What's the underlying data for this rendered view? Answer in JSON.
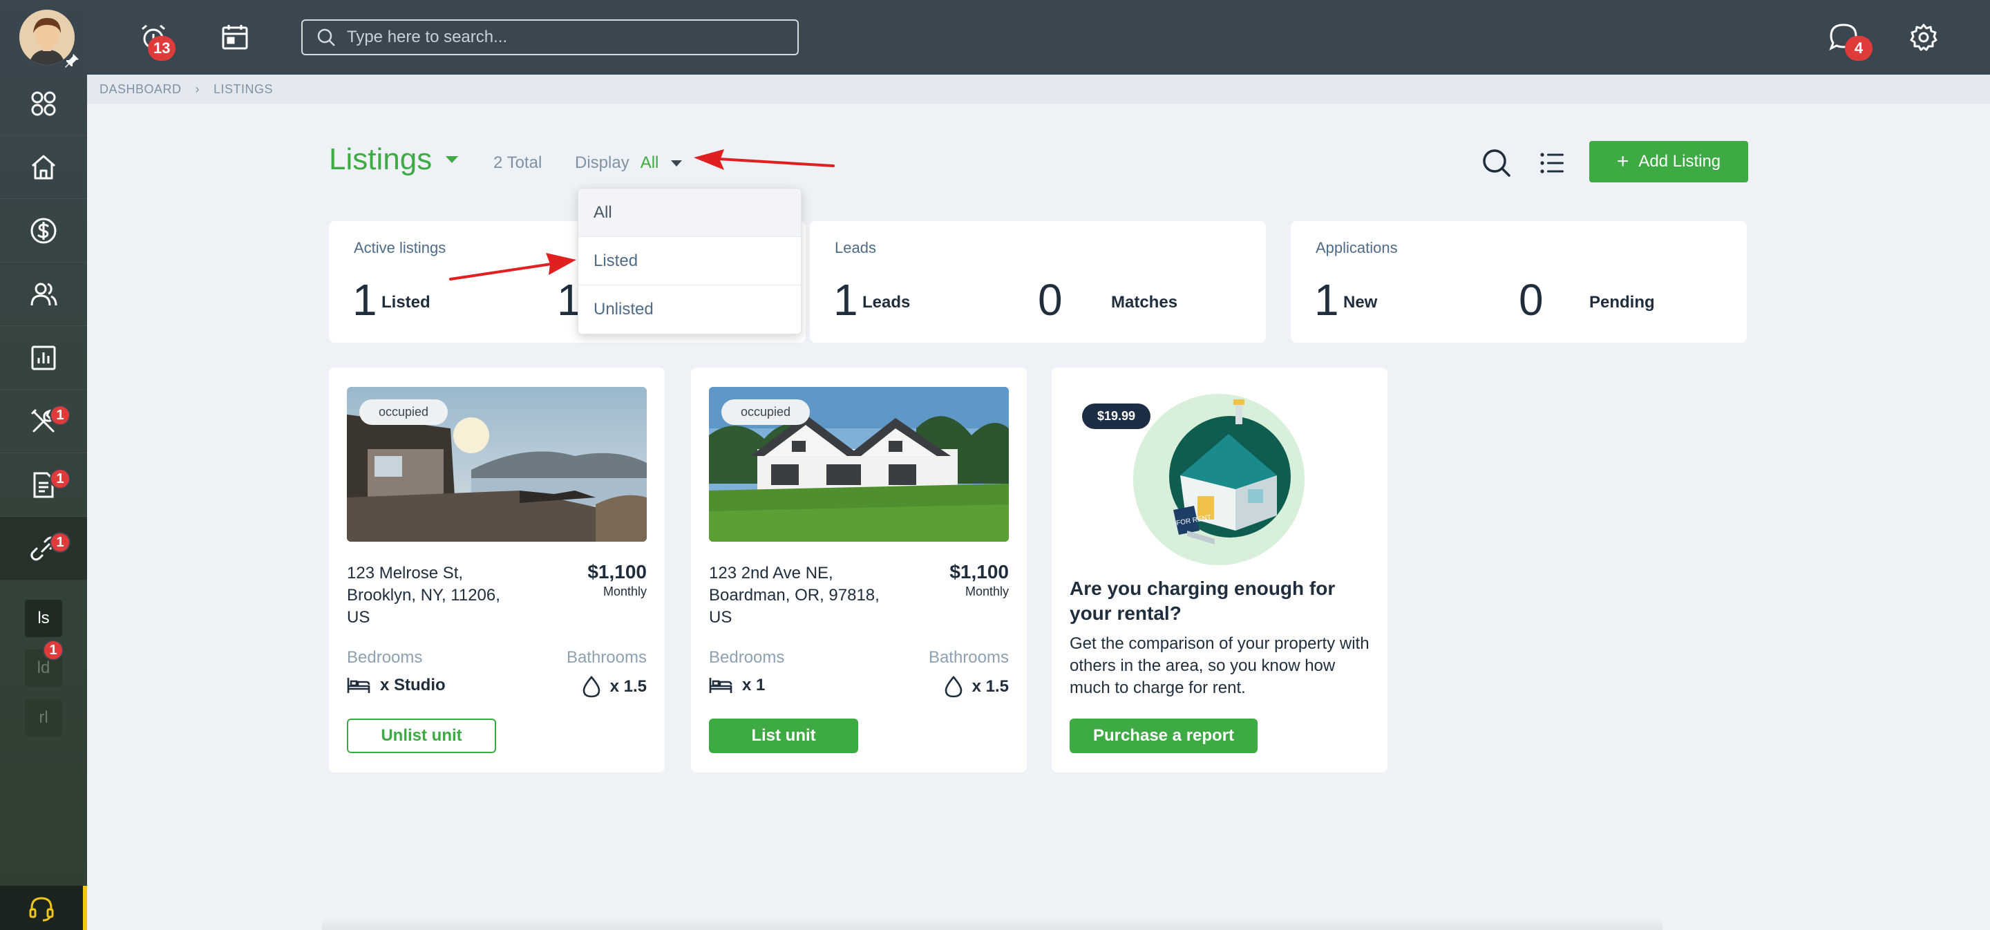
{
  "topbar": {
    "notifications_count": "13",
    "messages_count": "4",
    "search_placeholder": "Type here to search..."
  },
  "sidebar": {
    "badges": {
      "tools": "1",
      "documents": "1",
      "links": "1",
      "mini_ld": "1"
    },
    "mini_items": [
      "ls",
      "ld",
      "rl"
    ]
  },
  "breadcrumb": {
    "items": [
      "DASHBOARD",
      "LISTINGS"
    ]
  },
  "header": {
    "title": "Listings",
    "total": "2 Total",
    "display_label": "Display",
    "display_value": "All",
    "add_button": "Add Listing"
  },
  "dropdown": {
    "options": [
      "All",
      "Listed",
      "Unlisted"
    ]
  },
  "stats": {
    "active": {
      "label": "Active listings",
      "n1": "1",
      "w1": "Listed",
      "n2": "1"
    },
    "leads": {
      "label": "Leads",
      "n1": "1",
      "w1": "Leads",
      "n2": "0",
      "w2": "Matches"
    },
    "applications": {
      "label": "Applications",
      "n1": "1",
      "w1": "New",
      "n2": "0",
      "w2": "Pending"
    }
  },
  "listings": [
    {
      "status": "occupied",
      "address": "123 Melrose St, Brooklyn, NY, 11206, US",
      "price": "$1,100",
      "period": "Monthly",
      "bed_label": "Bedrooms",
      "bed_value": "x Studio",
      "bath_label": "Bathrooms",
      "bath_value": "x 1.5",
      "action": "Unlist unit"
    },
    {
      "status": "occupied",
      "address": "123 2nd Ave NE, Boardman, OR, 97818, US",
      "price": "$1,100",
      "period": "Monthly",
      "bed_label": "Bedrooms",
      "bed_value": "x 1",
      "bath_label": "Bathrooms",
      "bath_value": "x 1.5",
      "action": "List unit"
    }
  ],
  "promo": {
    "price": "$19.99",
    "sign_text": "FOR RENT",
    "title": "Are you charging enough for your rental?",
    "body": "Get the comparison of your property with others in the area, so you know how much to charge for rent.",
    "button": "Purchase a report"
  },
  "colors": {
    "brand_green": "#3eaa44",
    "topbar": "#3a4650",
    "badge_red": "#e03b3b",
    "annotation_red": "#e02020"
  }
}
